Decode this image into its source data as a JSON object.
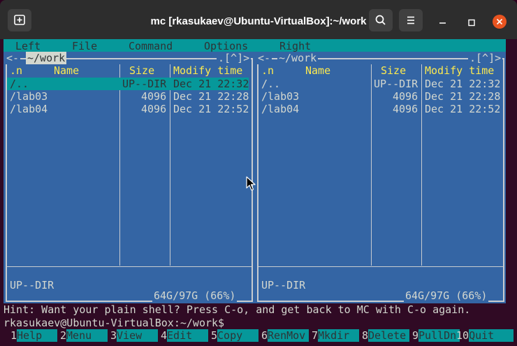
{
  "window": {
    "title": "mc [rkasukaev@Ubuntu-VirtualBox]:~/work",
    "new_tab_icon": "new-tab-icon",
    "search_icon": "search-icon",
    "menu_icon": "hamburger-menu-icon",
    "close_color": "#e95420"
  },
  "menu": {
    "left": "Left",
    "file": "File",
    "command": "Command",
    "options": "Options",
    "right": "Right"
  },
  "left_panel": {
    "path": "~/work",
    "corner": ".[^]>",
    "left_arrow": "<-",
    "col_n": ".n",
    "col_name": "Name",
    "col_size": "Size",
    "col_time": "Modify time",
    "rows": [
      {
        "name": "/..",
        "size": "UP--DIR",
        "time": "Dec 21 22:32"
      },
      {
        "name": "/lab03",
        "size": "4096",
        "time": "Dec 21 22:28"
      },
      {
        "name": "/lab04",
        "size": "4096",
        "time": "Dec 21 22:52"
      }
    ],
    "status": "UP--DIR",
    "disk": "64G/97G (66%)"
  },
  "right_panel": {
    "path": "~/work",
    "corner": ".[^]>",
    "left_arrow": "<-",
    "col_n": ".n",
    "col_name": "Name",
    "col_size": "Size",
    "col_time": "Modify time",
    "rows": [
      {
        "name": "/..",
        "size": "UP--DIR",
        "time": "Dec 21 22:32"
      },
      {
        "name": "/lab03",
        "size": "4096",
        "time": "Dec 21 22:28"
      },
      {
        "name": "/lab04",
        "size": "4096",
        "time": "Dec 21 22:52"
      }
    ],
    "status": "UP--DIR",
    "disk": "64G/97G (66%)"
  },
  "hint": "Hint: Want your plain shell? Press C-o, and get back to MC with C-o again.",
  "prompt": "rkasukaev@Ubuntu-VirtualBox:~/work$",
  "fkeys": [
    {
      "num": "1",
      "label": "Help"
    },
    {
      "num": "2",
      "label": "Menu"
    },
    {
      "num": "3",
      "label": "View"
    },
    {
      "num": "4",
      "label": "Edit"
    },
    {
      "num": "5",
      "label": "Copy"
    },
    {
      "num": "6",
      "label": "RenMov"
    },
    {
      "num": "7",
      "label": "Mkdir"
    },
    {
      "num": "8",
      "label": "Delete"
    },
    {
      "num": "9",
      "label": "PullDn"
    },
    {
      "num": "10",
      "label": "Quit"
    }
  ],
  "colors": {
    "panel_bg": "#3465a4",
    "selection": "#06989a",
    "header_text": "#fce94f",
    "terminal_bg": "#300a24"
  }
}
